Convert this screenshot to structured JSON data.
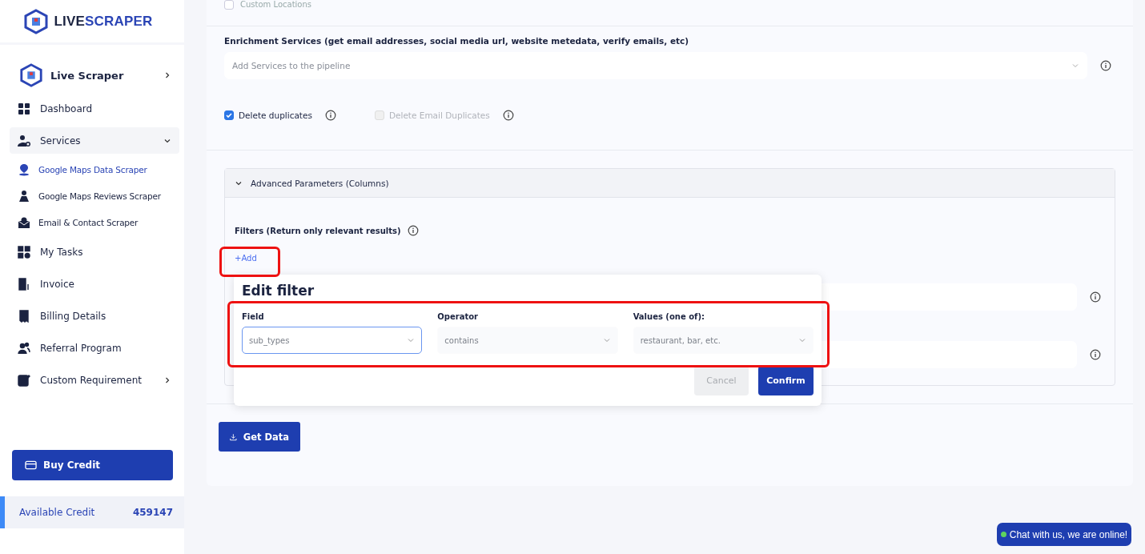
{
  "brand": {
    "name_dark": "LIVE",
    "name_accent": "SCRAPER"
  },
  "sidebar": {
    "items": [
      {
        "label": "Live Scraper",
        "kind": "product",
        "expanded": false,
        "selected": false
      },
      {
        "label": "Dashboard",
        "kind": "link",
        "selected": false
      },
      {
        "label": "Services",
        "kind": "group",
        "expanded": true,
        "selected": false,
        "children": [
          {
            "label": "Google Maps Data Scraper",
            "selected": true
          },
          {
            "label": "Google Maps Reviews Scraper",
            "selected": false
          },
          {
            "label": "Email & Contact Scraper",
            "selected": false
          }
        ]
      },
      {
        "label": "My Tasks",
        "kind": "link",
        "selected": false
      },
      {
        "label": "Invoice",
        "kind": "link",
        "selected": false
      },
      {
        "label": "Billing Details",
        "kind": "link",
        "selected": false
      },
      {
        "label": "Referral Program",
        "kind": "link",
        "selected": false
      },
      {
        "label": "Custom Requirement",
        "kind": "group",
        "expanded": false,
        "selected": false
      }
    ],
    "buy_button": "Buy Credit",
    "credit": {
      "label": "Available Credit",
      "value": "459147"
    }
  },
  "form": {
    "custom_locations": {
      "label": "Custom Locations",
      "checked": false
    },
    "enrichment": {
      "label": "Enrichment Services (get email addresses, social media url, website metedata, verify emails, etc)",
      "placeholder": "Add Services to the pipeline"
    },
    "options": [
      {
        "label": "Delete duplicates",
        "checked": true,
        "disabled": false
      },
      {
        "label": "Delete Email Duplicates",
        "checked": false,
        "disabled": true
      }
    ],
    "advanced": {
      "title": "Advanced Parameters (Columns)",
      "expanded": true,
      "filters_label": "Filters (Return only relevant results)",
      "add_link": "+Add"
    },
    "get_data": "Get Data"
  },
  "dialog": {
    "title": "Edit filter",
    "fields": [
      {
        "label": "Field",
        "value": "sub_types",
        "focused": true
      },
      {
        "label": "Operator",
        "value": "contains",
        "focused": false
      },
      {
        "label": "Values (one of):",
        "value": "restaurant, bar, etc.",
        "focused": false
      }
    ],
    "cancel": {
      "label": "Cancel",
      "disabled": true
    },
    "confirm": "Confirm"
  },
  "chat": {
    "label": "Chat with us, we are online!",
    "online": true
  }
}
